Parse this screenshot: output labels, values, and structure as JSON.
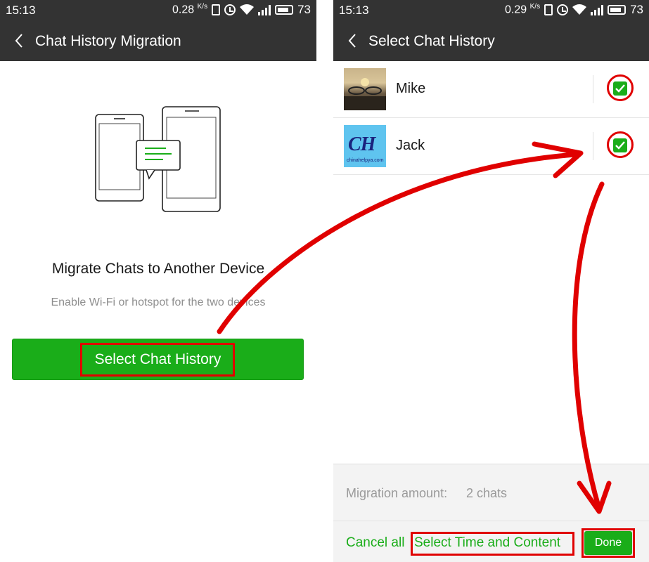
{
  "colors": {
    "accent_green": "#1aad19",
    "header_dark": "#333333",
    "annotation_red": "#e00000"
  },
  "left_screen": {
    "status": {
      "time": "15:13",
      "speed": "0.28",
      "speed_unit": "K/s",
      "battery": "73"
    },
    "header": {
      "back_icon": "chevron-left-icon",
      "title": "Chat History Migration"
    },
    "illustration_icon": "two-phones-chat-icon",
    "heading": "Migrate Chats to Another Device",
    "subtext": "Enable Wi-Fi or hotspot for the two devices",
    "primary_button": "Select Chat History"
  },
  "right_screen": {
    "status": {
      "time": "15:13",
      "speed": "0.29",
      "speed_unit": "K/s",
      "battery": "73"
    },
    "header": {
      "back_icon": "chevron-left-icon",
      "title": "Select Chat History"
    },
    "contacts": [
      {
        "name": "Mike",
        "checked": true
      },
      {
        "name": "Jack",
        "checked": true,
        "avatar_text": "CH",
        "avatar_url": "chinahelpya.com"
      }
    ],
    "migration_label": "Migration amount:",
    "migration_value": "2 chats",
    "footer": {
      "cancel_all": "Cancel all",
      "select_time": "Select Time and Content",
      "done": "Done"
    }
  }
}
